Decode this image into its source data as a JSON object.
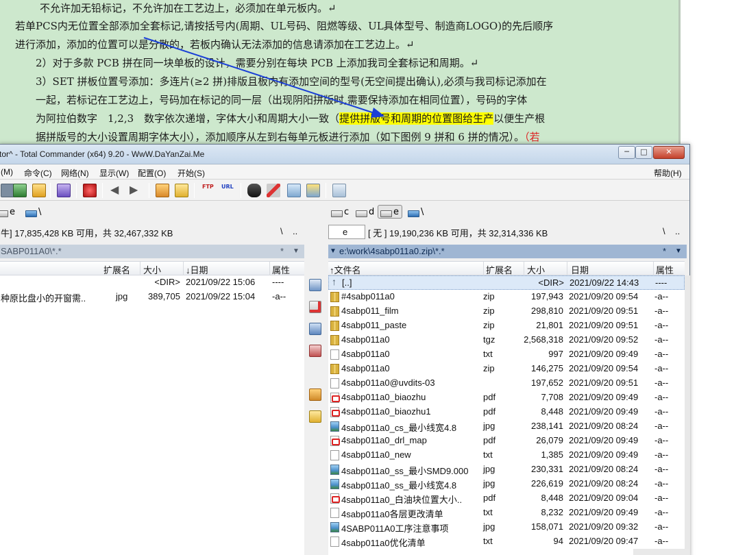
{
  "document": {
    "lines": [
      "不允许加无铅标记，不允许加在工艺边上，必须加在单元板内。↵",
      "若单PCS内无位置全部添加全套标记,请按括号内(周期、UL号码、阻燃等级、UL具体型号、制造商LOGO)的先后顺序",
      "进行添加，添加的位置可以是分散的，若板内确认无法添加的信息请添加在工艺边上。↵",
      "2）对于多款 PCB 拼在同一块单板的设计，需要分别在每块 PCB 上添加我司全套标记和周期。↵",
      "3）SET 拼板位置号添加：多连片(≥2 拼)排版且板内有添加空间的型号(无空间提出确认),必须与我司标记添加在",
      "一起，若标记在工艺边上，号码加在标记的同一层（出现阴阳拼版时,需要保持添加在相同位置），号码的字体",
      "为阿拉伯数字　1,2,3　数字依次递增，字体大小和周期大小一致（",
      "据拼版号的大小设置周期字体大小），添加顺序从左到右每单元板进行添加（如下图例 9 拼和 6 拼的情况）。"
    ],
    "highlight": "提供拼版号和周期的位置图给生产",
    "line7_tail": "以便生产根",
    "line8_tail": "（若"
  },
  "window": {
    "title": "tor^ - Total Commander (x64) 9.20 - WwW.DaYanZai.Me",
    "min_glyph": "─",
    "max_glyph": "□",
    "close_glyph": "✕"
  },
  "menu": {
    "items": [
      "(M)",
      "命令(C)",
      "网络(N)",
      "显示(W)",
      "配置(O)",
      "开始(S)"
    ],
    "help": "帮助(H)"
  },
  "left_panel": {
    "drive_letter": "e",
    "root_symbol": "\\",
    "free_space": "牛] 17,835,428 KB 可用，共 32,467,332 KB",
    "backslash": "\\",
    "dots": "..",
    "path": "SABP011A0\\*.*",
    "filter": "*",
    "headers": {
      "ext": "扩展名",
      "size": "大小",
      "date": "↓日期",
      "attr": "属性"
    },
    "rows": [
      {
        "name": "",
        "ext": "",
        "size": "<DIR>",
        "date": "2021/09/22 15:06",
        "attr": "----"
      },
      {
        "name": "种原比盘小的开窗需..",
        "ext": "jpg",
        "size": "389,705",
        "date": "2021/09/22 15:04",
        "attr": "-a--"
      }
    ]
  },
  "right_panel": {
    "drives": [
      "c",
      "d",
      "e"
    ],
    "root_symbol": "\\",
    "combo_drive": "e",
    "free_space": "[ 无 ]  19,190,236 KB 可用，共 32,314,336 KB",
    "backslash": "\\",
    "dots": "..",
    "path": "e:\\work\\4sabp011a0.zip\\*.*",
    "filter": "*",
    "headers": {
      "name": "↑文件名",
      "ext": "扩展名",
      "size": "大小",
      "date": "日期",
      "attr": "属性"
    },
    "rows": [
      {
        "icon": "up",
        "name": "[..]",
        "ext": "",
        "size": "<DIR>",
        "date": "2021/09/22 14:43",
        "attr": "----"
      },
      {
        "icon": "zip",
        "name": "#4sabp011a0",
        "ext": "zip",
        "size": "197,943",
        "date": "2021/09/20 09:54",
        "attr": "-a--"
      },
      {
        "icon": "zip",
        "name": "4sabp011_film",
        "ext": "zip",
        "size": "298,810",
        "date": "2021/09/20 09:51",
        "attr": "-a--"
      },
      {
        "icon": "zip",
        "name": "4sabp011_paste",
        "ext": "zip",
        "size": "21,801",
        "date": "2021/09/20 09:51",
        "attr": "-a--"
      },
      {
        "icon": "zip",
        "name": "4sabp011a0",
        "ext": "tgz",
        "size": "2,568,318",
        "date": "2021/09/20 09:52",
        "attr": "-a--"
      },
      {
        "icon": "txt",
        "name": "4sabp011a0",
        "ext": "txt",
        "size": "997",
        "date": "2021/09/20 09:49",
        "attr": "-a--"
      },
      {
        "icon": "zip",
        "name": "4sabp011a0",
        "ext": "zip",
        "size": "146,275",
        "date": "2021/09/20 09:54",
        "attr": "-a--"
      },
      {
        "icon": "txt",
        "name": "4sabp011a0@uvdits-03",
        "ext": "",
        "size": "197,652",
        "date": "2021/09/20 09:51",
        "attr": "-a--"
      },
      {
        "icon": "pdf",
        "name": "4sabp011a0_biaozhu",
        "ext": "pdf",
        "size": "7,708",
        "date": "2021/09/20 09:49",
        "attr": "-a--"
      },
      {
        "icon": "pdf",
        "name": "4sabp011a0_biaozhu1",
        "ext": "pdf",
        "size": "8,448",
        "date": "2021/09/20 09:49",
        "attr": "-a--"
      },
      {
        "icon": "jpg",
        "name": "4sabp011a0_cs_最小线宽4.8",
        "ext": "jpg",
        "size": "238,141",
        "date": "2021/09/20 08:24",
        "attr": "-a--"
      },
      {
        "icon": "pdf",
        "name": "4sabp011a0_drl_map",
        "ext": "pdf",
        "size": "26,079",
        "date": "2021/09/20 09:49",
        "attr": "-a--"
      },
      {
        "icon": "txt",
        "name": "4sabp011a0_new",
        "ext": "txt",
        "size": "1,385",
        "date": "2021/09/20 09:49",
        "attr": "-a--"
      },
      {
        "icon": "jpg",
        "name": "4sabp011a0_ss_最小SMD9.000",
        "ext": "jpg",
        "size": "230,331",
        "date": "2021/09/20 08:24",
        "attr": "-a--"
      },
      {
        "icon": "jpg",
        "name": "4sabp011a0_ss_最小线宽4.8",
        "ext": "jpg",
        "size": "226,619",
        "date": "2021/09/20 08:24",
        "attr": "-a--"
      },
      {
        "icon": "pdf",
        "name": "4sabp011a0_白油块位置大小..",
        "ext": "pdf",
        "size": "8,448",
        "date": "2021/09/20 09:04",
        "attr": "-a--"
      },
      {
        "icon": "txt",
        "name": "4sabp011a0各层更改清单",
        "ext": "txt",
        "size": "8,232",
        "date": "2021/09/20 09:49",
        "attr": "-a--"
      },
      {
        "icon": "jpg",
        "name": "4SABP011A0工序注意事项",
        "ext": "jpg",
        "size": "158,071",
        "date": "2021/09/20 09:32",
        "attr": "-a--"
      },
      {
        "icon": "txt",
        "name": "4sabp011a0优化清单",
        "ext": "txt",
        "size": "94",
        "date": "2021/09/20 09:47",
        "attr": "-a--"
      }
    ]
  },
  "colors": {
    "doc_bg": "#cde8cd",
    "highlight": "#ffff00",
    "arrow": "#1a3fd6",
    "active_path": "#9fb6d3",
    "selected_row": "#dce9f8"
  }
}
